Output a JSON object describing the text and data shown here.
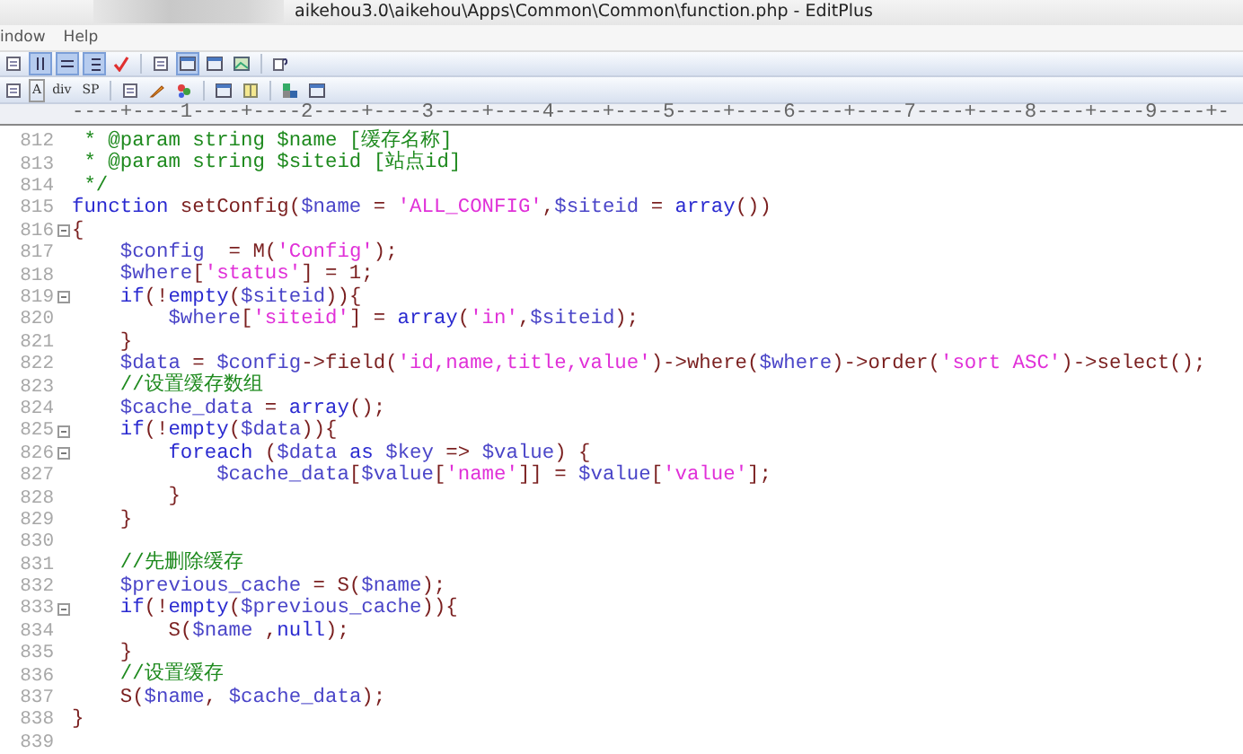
{
  "window": {
    "title": "aikehou3.0\\aikehou\\Apps\\Common\\Common\\function.php - EditPlus"
  },
  "menu": [
    "indow",
    "Help"
  ],
  "toolbar2_labels": [
    "A",
    "div",
    "SP"
  ],
  "ruler": "----+----1----+----2----+----3----+----4----+----5----+----6----+----7----+----8----+----9----+-",
  "lines": [
    {
      "number": "812",
      "fold_marker": false,
      "tokens": [
        {
          "kind": "comment",
          "text": " * @param string $name [缓存名称]"
        }
      ]
    },
    {
      "number": "813",
      "fold_marker": false,
      "tokens": [
        {
          "kind": "comment",
          "text": " * @param string $siteid [站点id]"
        }
      ]
    },
    {
      "number": "814",
      "fold_marker": false,
      "tokens": [
        {
          "kind": "comment",
          "text": " */"
        }
      ]
    },
    {
      "number": "815",
      "fold_marker": false,
      "tokens": [
        {
          "kind": "keyword",
          "text": "function"
        },
        {
          "kind": "plain",
          "text": " setConfig("
        },
        {
          "kind": "var",
          "text": "$name"
        },
        {
          "kind": "plain",
          "text": " = "
        },
        {
          "kind": "string",
          "text": "'ALL_CONFIG'"
        },
        {
          "kind": "plain",
          "text": ","
        },
        {
          "kind": "var",
          "text": "$siteid"
        },
        {
          "kind": "plain",
          "text": " = "
        },
        {
          "kind": "keyword",
          "text": "array"
        },
        {
          "kind": "plain",
          "text": "())"
        }
      ]
    },
    {
      "number": "816",
      "fold_marker": true,
      "tokens": [
        {
          "kind": "plain",
          "text": "{"
        }
      ]
    },
    {
      "number": "817",
      "fold_marker": false,
      "tokens": [
        {
          "kind": "var",
          "text": "    $config"
        },
        {
          "kind": "plain",
          "text": "  = M("
        },
        {
          "kind": "string",
          "text": "'Config'"
        },
        {
          "kind": "plain",
          "text": ");"
        }
      ]
    },
    {
      "number": "818",
      "fold_marker": false,
      "tokens": [
        {
          "kind": "var",
          "text": "    $where"
        },
        {
          "kind": "plain",
          "text": "["
        },
        {
          "kind": "string",
          "text": "'status'"
        },
        {
          "kind": "plain",
          "text": "] = 1;"
        }
      ]
    },
    {
      "number": "819",
      "fold_marker": true,
      "tokens": [
        {
          "kind": "keyword",
          "text": "    if"
        },
        {
          "kind": "plain",
          "text": "(!"
        },
        {
          "kind": "keyword",
          "text": "empty"
        },
        {
          "kind": "plain",
          "text": "("
        },
        {
          "kind": "var",
          "text": "$siteid"
        },
        {
          "kind": "plain",
          "text": ")){"
        }
      ]
    },
    {
      "number": "820",
      "fold_marker": false,
      "tokens": [
        {
          "kind": "var",
          "text": "        $where"
        },
        {
          "kind": "plain",
          "text": "["
        },
        {
          "kind": "string",
          "text": "'siteid'"
        },
        {
          "kind": "plain",
          "text": "] = "
        },
        {
          "kind": "keyword",
          "text": "array"
        },
        {
          "kind": "plain",
          "text": "("
        },
        {
          "kind": "string",
          "text": "'in'"
        },
        {
          "kind": "plain",
          "text": ","
        },
        {
          "kind": "var",
          "text": "$siteid"
        },
        {
          "kind": "plain",
          "text": ");"
        }
      ]
    },
    {
      "number": "821",
      "fold_marker": false,
      "tokens": [
        {
          "kind": "plain",
          "text": "    }"
        }
      ]
    },
    {
      "number": "822",
      "fold_marker": false,
      "tokens": [
        {
          "kind": "var",
          "text": "    $data"
        },
        {
          "kind": "plain",
          "text": " = "
        },
        {
          "kind": "var",
          "text": "$config"
        },
        {
          "kind": "plain",
          "text": "->field("
        },
        {
          "kind": "string",
          "text": "'id,name,title,value'"
        },
        {
          "kind": "plain",
          "text": ")->where("
        },
        {
          "kind": "var",
          "text": "$where"
        },
        {
          "kind": "plain",
          "text": ")->order("
        },
        {
          "kind": "string",
          "text": "'sort ASC'"
        },
        {
          "kind": "plain",
          "text": ")->select();"
        }
      ]
    },
    {
      "number": "823",
      "fold_marker": false,
      "tokens": [
        {
          "kind": "comment",
          "text": "    //设置缓存数组"
        }
      ]
    },
    {
      "number": "824",
      "fold_marker": false,
      "tokens": [
        {
          "kind": "var",
          "text": "    $cache_data"
        },
        {
          "kind": "plain",
          "text": " = "
        },
        {
          "kind": "keyword",
          "text": "array"
        },
        {
          "kind": "plain",
          "text": "();"
        }
      ]
    },
    {
      "number": "825",
      "fold_marker": true,
      "tokens": [
        {
          "kind": "keyword",
          "text": "    if"
        },
        {
          "kind": "plain",
          "text": "(!"
        },
        {
          "kind": "keyword",
          "text": "empty"
        },
        {
          "kind": "plain",
          "text": "("
        },
        {
          "kind": "var",
          "text": "$data"
        },
        {
          "kind": "plain",
          "text": ")){"
        }
      ]
    },
    {
      "number": "826",
      "fold_marker": true,
      "tokens": [
        {
          "kind": "keyword",
          "text": "        foreach"
        },
        {
          "kind": "plain",
          "text": " ("
        },
        {
          "kind": "var",
          "text": "$data "
        },
        {
          "kind": "keyword",
          "text": "as "
        },
        {
          "kind": "var",
          "text": "$key"
        },
        {
          "kind": "plain",
          "text": " => "
        },
        {
          "kind": "var",
          "text": "$value"
        },
        {
          "kind": "plain",
          "text": ") {"
        }
      ]
    },
    {
      "number": "827",
      "fold_marker": false,
      "tokens": [
        {
          "kind": "var",
          "text": "            $cache_data"
        },
        {
          "kind": "plain",
          "text": "["
        },
        {
          "kind": "var",
          "text": "$value"
        },
        {
          "kind": "plain",
          "text": "["
        },
        {
          "kind": "string",
          "text": "'name'"
        },
        {
          "kind": "plain",
          "text": "]] = "
        },
        {
          "kind": "var",
          "text": "$value"
        },
        {
          "kind": "plain",
          "text": "["
        },
        {
          "kind": "string",
          "text": "'value'"
        },
        {
          "kind": "plain",
          "text": "];"
        }
      ]
    },
    {
      "number": "828",
      "fold_marker": false,
      "tokens": [
        {
          "kind": "plain",
          "text": "        }"
        }
      ]
    },
    {
      "number": "829",
      "fold_marker": false,
      "tokens": [
        {
          "kind": "plain",
          "text": "    }"
        }
      ]
    },
    {
      "number": "830",
      "fold_marker": false
    },
    {
      "number": "831",
      "fold_marker": false,
      "tokens": [
        {
          "kind": "comment",
          "text": "    //先删除缓存"
        }
      ]
    },
    {
      "number": "832",
      "fold_marker": false,
      "tokens": [
        {
          "kind": "var",
          "text": "    $previous_cache"
        },
        {
          "kind": "plain",
          "text": " = S("
        },
        {
          "kind": "var",
          "text": "$name"
        },
        {
          "kind": "plain",
          "text": ");"
        }
      ]
    },
    {
      "number": "833",
      "fold_marker": true,
      "tokens": [
        {
          "kind": "keyword",
          "text": "    if"
        },
        {
          "kind": "plain",
          "text": "(!"
        },
        {
          "kind": "keyword",
          "text": "empty"
        },
        {
          "kind": "plain",
          "text": "("
        },
        {
          "kind": "var",
          "text": "$previous_cache"
        },
        {
          "kind": "plain",
          "text": ")){"
        }
      ]
    },
    {
      "number": "834",
      "fold_marker": false,
      "tokens": [
        {
          "kind": "plain",
          "text": "        S("
        },
        {
          "kind": "var",
          "text": "$name"
        },
        {
          "kind": "plain",
          "text": " ,"
        },
        {
          "kind": "keyword",
          "text": "null"
        },
        {
          "kind": "plain",
          "text": ");"
        }
      ]
    },
    {
      "number": "835",
      "fold_marker": false,
      "tokens": [
        {
          "kind": "plain",
          "text": "    }"
        }
      ]
    },
    {
      "number": "836",
      "fold_marker": false,
      "tokens": [
        {
          "kind": "comment",
          "text": "    //设置缓存"
        }
      ]
    },
    {
      "number": "837",
      "fold_marker": false,
      "tokens": [
        {
          "kind": "plain",
          "text": "    S("
        },
        {
          "kind": "var",
          "text": "$name"
        },
        {
          "kind": "plain",
          "text": ", "
        },
        {
          "kind": "var",
          "text": "$cache_data"
        },
        {
          "kind": "plain",
          "text": ");"
        }
      ]
    },
    {
      "number": "838",
      "fold_marker": false,
      "tokens": [
        {
          "kind": "plain",
          "text": "}"
        }
      ]
    },
    {
      "number": "839",
      "fold_marker": false
    }
  ]
}
